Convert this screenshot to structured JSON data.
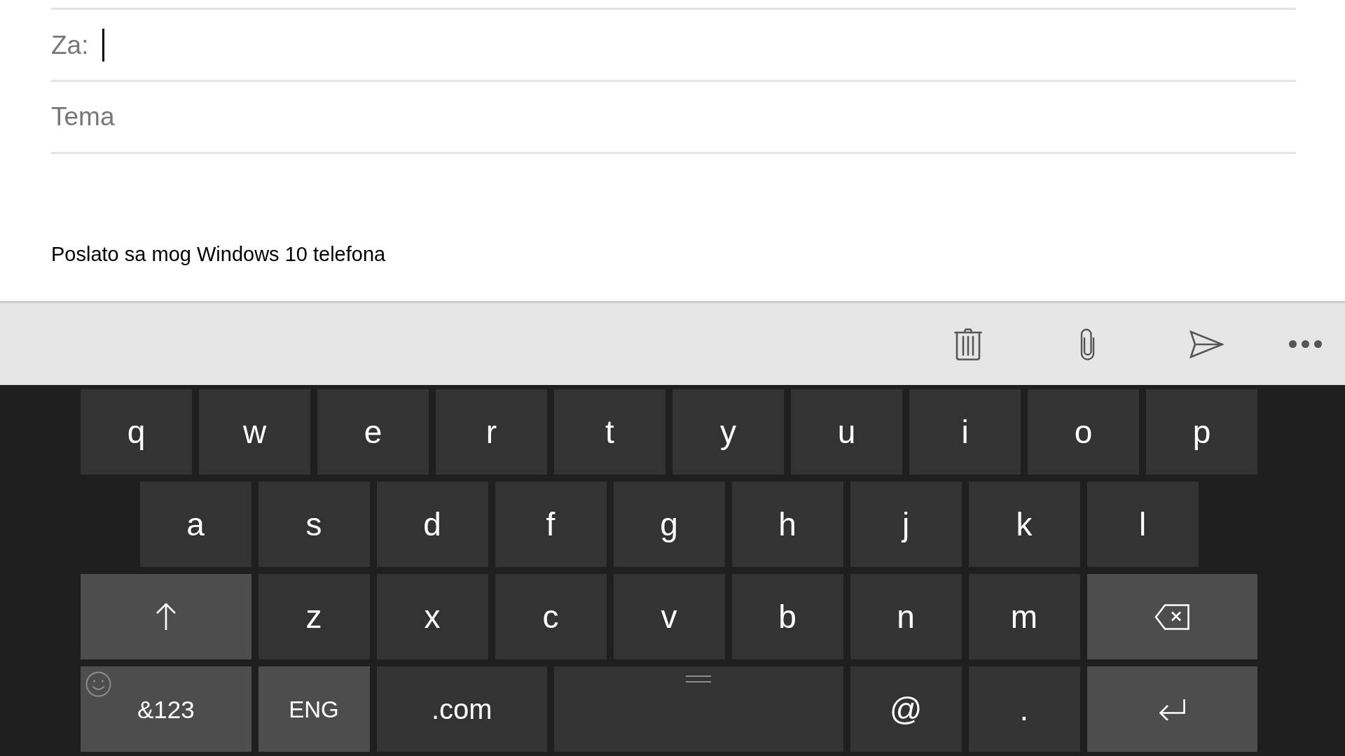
{
  "compose": {
    "to_field": {
      "label": "Za:",
      "focused": true
    },
    "subject_field": {
      "placeholder": "Tema"
    },
    "signature": "Poslato sa mog Windows 10 telefona"
  },
  "toolbar": {
    "actions": [
      {
        "kind": "delete"
      },
      {
        "kind": "attach"
      },
      {
        "kind": "send"
      },
      {
        "kind": "more"
      }
    ]
  },
  "keyboard": {
    "rows": [
      {
        "keys": [
          {
            "kind": "letter",
            "label": "q"
          },
          {
            "kind": "letter",
            "label": "w"
          },
          {
            "kind": "letter",
            "label": "e"
          },
          {
            "kind": "letter",
            "label": "r"
          },
          {
            "kind": "letter",
            "label": "t"
          },
          {
            "kind": "letter",
            "label": "y"
          },
          {
            "kind": "letter",
            "label": "u"
          },
          {
            "kind": "letter",
            "label": "i"
          },
          {
            "kind": "letter",
            "label": "o"
          },
          {
            "kind": "letter",
            "label": "p"
          }
        ]
      },
      {
        "keys": [
          {
            "kind": "letter",
            "label": "a"
          },
          {
            "kind": "letter",
            "label": "s"
          },
          {
            "kind": "letter",
            "label": "d"
          },
          {
            "kind": "letter",
            "label": "f"
          },
          {
            "kind": "letter",
            "label": "g"
          },
          {
            "kind": "letter",
            "label": "h"
          },
          {
            "kind": "letter",
            "label": "j"
          },
          {
            "kind": "letter",
            "label": "k"
          },
          {
            "kind": "letter",
            "label": "l"
          }
        ]
      },
      {
        "keys": [
          {
            "kind": "shift"
          },
          {
            "kind": "letter",
            "label": "z"
          },
          {
            "kind": "letter",
            "label": "x"
          },
          {
            "kind": "letter",
            "label": "c"
          },
          {
            "kind": "letter",
            "label": "v"
          },
          {
            "kind": "letter",
            "label": "b"
          },
          {
            "kind": "letter",
            "label": "n"
          },
          {
            "kind": "letter",
            "label": "m"
          },
          {
            "kind": "backspace"
          }
        ]
      },
      {
        "keys": [
          {
            "kind": "symbols",
            "label": "&123"
          },
          {
            "kind": "language",
            "label": "ENG"
          },
          {
            "kind": "domain",
            "label": ".com"
          },
          {
            "kind": "space"
          },
          {
            "kind": "char",
            "label": "@"
          },
          {
            "kind": "char",
            "label": "."
          },
          {
            "kind": "enter"
          }
        ]
      }
    ]
  }
}
